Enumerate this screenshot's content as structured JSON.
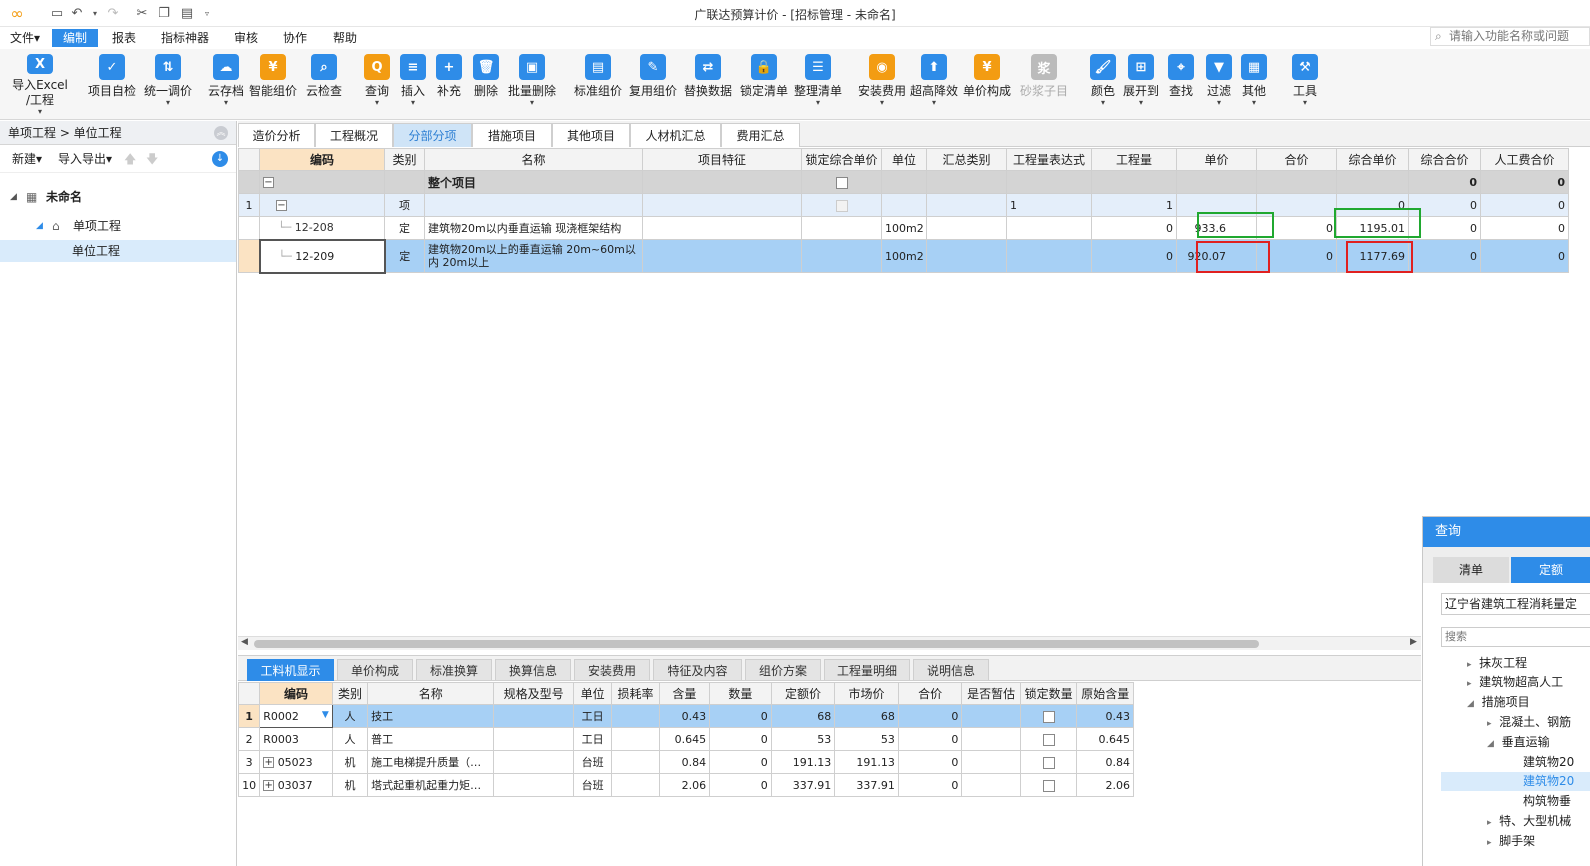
{
  "app": {
    "title": "广联达预算计价 - [招标管理 - 未命名]",
    "search_placeholder": "请输入功能名称或问题"
  },
  "menu": [
    "文件▾",
    "编制",
    "报表",
    "指标神器",
    "审核",
    "协作",
    "帮助"
  ],
  "ribbon": [
    {
      "label": "导入Excel\n/工程",
      "icon": "import-excel-icon",
      "color": "#2e8ce8"
    },
    {
      "label": "项目自检",
      "icon": "project-check-icon",
      "color": "#2e8ce8"
    },
    {
      "label": "统一调价",
      "icon": "adjust-price-icon",
      "color": "#2e8ce8"
    },
    {
      "label": "云存档",
      "icon": "cloud-save-icon",
      "color": "#2e8ce8"
    },
    {
      "label": "智能组价",
      "icon": "smart-pricing-icon",
      "color": "#f39c12"
    },
    {
      "label": "云检查",
      "icon": "cloud-check-icon",
      "color": "#2e8ce8"
    },
    {
      "label": "查询",
      "icon": "query-icon",
      "color": "#f39c12"
    },
    {
      "label": "插入",
      "icon": "insert-icon",
      "color": "#2e8ce8"
    },
    {
      "label": "补充",
      "icon": "supplement-icon",
      "color": "#2e8ce8"
    },
    {
      "label": "删除",
      "icon": "delete-icon",
      "color": "#2e8ce8"
    },
    {
      "label": "批量删除",
      "icon": "batch-delete-icon",
      "color": "#2e8ce8"
    },
    {
      "label": "标准组价",
      "icon": "standard-pricing-icon",
      "color": "#2e8ce8"
    },
    {
      "label": "复用组价",
      "icon": "reuse-pricing-icon",
      "color": "#2e8ce8"
    },
    {
      "label": "替换数据",
      "icon": "replace-data-icon",
      "color": "#2e8ce8"
    },
    {
      "label": "锁定清单",
      "icon": "lock-list-icon",
      "color": "#2e8ce8"
    },
    {
      "label": "整理清单",
      "icon": "organize-list-icon",
      "color": "#2e8ce8"
    },
    {
      "label": "安装费用",
      "icon": "install-fee-icon",
      "color": "#f39c12"
    },
    {
      "label": "超高降效",
      "icon": "height-efficiency-icon",
      "color": "#2e8ce8"
    },
    {
      "label": "单价构成",
      "icon": "unit-price-composition-icon",
      "color": "#f39c12"
    },
    {
      "label": "砂浆子目",
      "icon": "mortar-item-icon",
      "color": "#bbbbbb"
    },
    {
      "label": "颜色",
      "icon": "color-icon",
      "color": "#2e8ce8"
    },
    {
      "label": "展开到",
      "icon": "expand-to-icon",
      "color": "#2e8ce8"
    },
    {
      "label": "查找",
      "icon": "find-icon",
      "color": "#2e8ce8"
    },
    {
      "label": "过滤",
      "icon": "filter-icon",
      "color": "#2e8ce8"
    },
    {
      "label": "其他",
      "icon": "other-icon",
      "color": "#2e8ce8"
    },
    {
      "label": "工具",
      "icon": "tools-icon",
      "color": "#2e8ce8"
    }
  ],
  "left_panel": {
    "breadcrumb": "单项工程 > 单位工程",
    "new_label": "新建▾",
    "import_export_label": "导入导出▾",
    "tree": [
      {
        "label": "未命名",
        "level": 0
      },
      {
        "label": "单项工程",
        "level": 1
      },
      {
        "label": "单位工程",
        "level": 2
      }
    ]
  },
  "main_tabs": [
    "造价分析",
    "工程概况",
    "分部分项",
    "措施项目",
    "其他项目",
    "人材机汇总",
    "费用汇总"
  ],
  "grid": {
    "headers": [
      "编码",
      "类别",
      "名称",
      "项目特征",
      "锁定综合单价",
      "单位",
      "汇总类别",
      "工程量表达式",
      "工程量",
      "单价",
      "合价",
      "综合单价",
      "综合合价",
      "人工费合价"
    ],
    "rows": [
      {
        "no": "",
        "code": "",
        "type": "",
        "name": "整个项目",
        "unit": "",
        "expr": "",
        "qty": "",
        "price": "",
        "total": "",
        "comp_price": "",
        "comp_total": "0",
        "labor": "0"
      },
      {
        "no": "1",
        "code": "",
        "type": "项",
        "name": "",
        "unit": "",
        "expr": "1",
        "qty": "1",
        "price": "",
        "total": "",
        "comp_price": "0",
        "comp_total": "0",
        "labor": "0"
      },
      {
        "no": "",
        "code": "12-208",
        "type": "定",
        "name": "建筑物20m以内垂直运输 现浇框架结构",
        "unit": "100m2",
        "expr": "",
        "qty": "0",
        "price": "933.6",
        "total": "0",
        "comp_price": "1195.01",
        "comp_total": "0",
        "labor": "0"
      },
      {
        "no": "",
        "code": "12-209",
        "type": "定",
        "name": "建筑物20m以上的垂直运输 20m~60m以内 20m以上",
        "unit": "100m2",
        "expr": "",
        "qty": "0",
        "price": "920.07",
        "total": "0",
        "comp_price": "1177.69",
        "comp_total": "0",
        "labor": "0"
      }
    ]
  },
  "bottom_tabs": [
    "工料机显示",
    "单价构成",
    "标准换算",
    "换算信息",
    "安装费用",
    "特征及内容",
    "组价方案",
    "工程量明细",
    "说明信息"
  ],
  "sub_grid": {
    "headers": [
      "编码",
      "类别",
      "名称",
      "规格及型号",
      "单位",
      "损耗率",
      "含量",
      "数量",
      "定额价",
      "市场价",
      "合价",
      "是否暂估",
      "锁定数量",
      "原始含量"
    ],
    "rows": [
      {
        "no": "1",
        "code": "R0002",
        "type": "人",
        "name": "技工",
        "spec": "",
        "unit": "工日",
        "loss": "",
        "content": "0.43",
        "qty": "0",
        "quota": "68",
        "market": "68",
        "total": "0",
        "orig": "0.43"
      },
      {
        "no": "2",
        "code": "R0003",
        "type": "人",
        "name": "普工",
        "spec": "",
        "unit": "工日",
        "loss": "",
        "content": "0.645",
        "qty": "0",
        "quota": "53",
        "market": "53",
        "total": "0",
        "orig": "0.645"
      },
      {
        "no": "3",
        "code": "05023",
        "type": "机",
        "name": "施工电梯提升质量（…",
        "spec": "",
        "unit": "台班",
        "loss": "",
        "content": "0.84",
        "qty": "0",
        "quota": "191.13",
        "market": "191.13",
        "total": "0",
        "orig": "0.84"
      },
      {
        "no": "10",
        "code": "03037",
        "type": "机",
        "name": "塔式起重机起重力矩…",
        "spec": "",
        "unit": "台班",
        "loss": "",
        "content": "2.06",
        "qty": "0",
        "quota": "337.91",
        "market": "337.91",
        "total": "0",
        "orig": "2.06"
      }
    ]
  },
  "query_panel": {
    "title": "查询",
    "tabs": [
      "清单",
      "定额"
    ],
    "library": "辽宁省建筑工程消耗量定",
    "search_placeholder": "搜索",
    "tree": [
      "抹灰工程",
      "建筑物超高人工",
      "措施项目",
      "混凝土、钢筋",
      "垂直运输",
      "建筑物20",
      "建筑物20",
      "构筑物垂",
      "特、大型机械",
      "脚手架"
    ]
  }
}
